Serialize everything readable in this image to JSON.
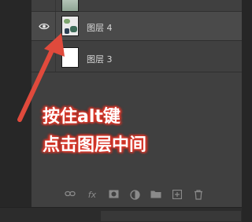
{
  "layers_panel": {
    "layers": [
      {
        "name": "",
        "visible": false
      },
      {
        "name": "图层 4",
        "visible": true,
        "selected": true,
        "visibility_icon": "eye-icon"
      },
      {
        "name": "图层 3",
        "visible": false
      }
    ]
  },
  "annotation": {
    "line1": "按住alt键",
    "line2": "点击图层中间",
    "color": "#e04a3c"
  },
  "toolbar": {
    "icons": [
      "link-layers-icon",
      "fx-icon",
      "add-mask-icon",
      "adjustment-layer-icon",
      "new-group-icon",
      "new-layer-icon",
      "delete-layer-icon"
    ],
    "fx_label": "fx"
  }
}
